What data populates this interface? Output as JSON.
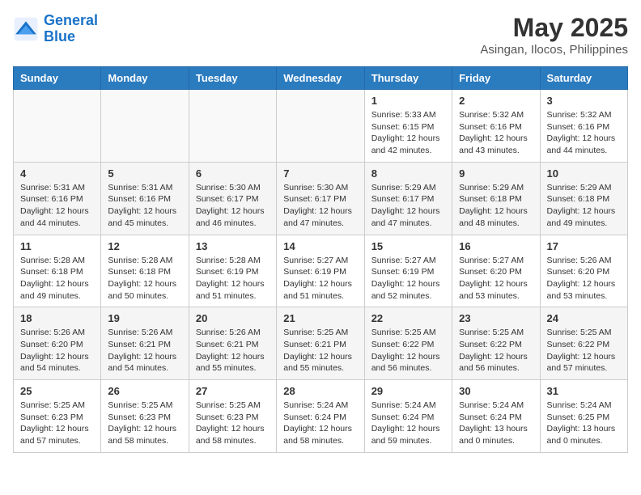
{
  "header": {
    "logo_line1": "General",
    "logo_line2": "Blue",
    "month": "May 2025",
    "location": "Asingan, Ilocos, Philippines"
  },
  "weekdays": [
    "Sunday",
    "Monday",
    "Tuesday",
    "Wednesday",
    "Thursday",
    "Friday",
    "Saturday"
  ],
  "weeks": [
    [
      {
        "day": "",
        "info": ""
      },
      {
        "day": "",
        "info": ""
      },
      {
        "day": "",
        "info": ""
      },
      {
        "day": "",
        "info": ""
      },
      {
        "day": "1",
        "info": "Sunrise: 5:33 AM\nSunset: 6:15 PM\nDaylight: 12 hours\nand 42 minutes."
      },
      {
        "day": "2",
        "info": "Sunrise: 5:32 AM\nSunset: 6:16 PM\nDaylight: 12 hours\nand 43 minutes."
      },
      {
        "day": "3",
        "info": "Sunrise: 5:32 AM\nSunset: 6:16 PM\nDaylight: 12 hours\nand 44 minutes."
      }
    ],
    [
      {
        "day": "4",
        "info": "Sunrise: 5:31 AM\nSunset: 6:16 PM\nDaylight: 12 hours\nand 44 minutes."
      },
      {
        "day": "5",
        "info": "Sunrise: 5:31 AM\nSunset: 6:16 PM\nDaylight: 12 hours\nand 45 minutes."
      },
      {
        "day": "6",
        "info": "Sunrise: 5:30 AM\nSunset: 6:17 PM\nDaylight: 12 hours\nand 46 minutes."
      },
      {
        "day": "7",
        "info": "Sunrise: 5:30 AM\nSunset: 6:17 PM\nDaylight: 12 hours\nand 47 minutes."
      },
      {
        "day": "8",
        "info": "Sunrise: 5:29 AM\nSunset: 6:17 PM\nDaylight: 12 hours\nand 47 minutes."
      },
      {
        "day": "9",
        "info": "Sunrise: 5:29 AM\nSunset: 6:18 PM\nDaylight: 12 hours\nand 48 minutes."
      },
      {
        "day": "10",
        "info": "Sunrise: 5:29 AM\nSunset: 6:18 PM\nDaylight: 12 hours\nand 49 minutes."
      }
    ],
    [
      {
        "day": "11",
        "info": "Sunrise: 5:28 AM\nSunset: 6:18 PM\nDaylight: 12 hours\nand 49 minutes."
      },
      {
        "day": "12",
        "info": "Sunrise: 5:28 AM\nSunset: 6:18 PM\nDaylight: 12 hours\nand 50 minutes."
      },
      {
        "day": "13",
        "info": "Sunrise: 5:28 AM\nSunset: 6:19 PM\nDaylight: 12 hours\nand 51 minutes."
      },
      {
        "day": "14",
        "info": "Sunrise: 5:27 AM\nSunset: 6:19 PM\nDaylight: 12 hours\nand 51 minutes."
      },
      {
        "day": "15",
        "info": "Sunrise: 5:27 AM\nSunset: 6:19 PM\nDaylight: 12 hours\nand 52 minutes."
      },
      {
        "day": "16",
        "info": "Sunrise: 5:27 AM\nSunset: 6:20 PM\nDaylight: 12 hours\nand 53 minutes."
      },
      {
        "day": "17",
        "info": "Sunrise: 5:26 AM\nSunset: 6:20 PM\nDaylight: 12 hours\nand 53 minutes."
      }
    ],
    [
      {
        "day": "18",
        "info": "Sunrise: 5:26 AM\nSunset: 6:20 PM\nDaylight: 12 hours\nand 54 minutes."
      },
      {
        "day": "19",
        "info": "Sunrise: 5:26 AM\nSunset: 6:21 PM\nDaylight: 12 hours\nand 54 minutes."
      },
      {
        "day": "20",
        "info": "Sunrise: 5:26 AM\nSunset: 6:21 PM\nDaylight: 12 hours\nand 55 minutes."
      },
      {
        "day": "21",
        "info": "Sunrise: 5:25 AM\nSunset: 6:21 PM\nDaylight: 12 hours\nand 55 minutes."
      },
      {
        "day": "22",
        "info": "Sunrise: 5:25 AM\nSunset: 6:22 PM\nDaylight: 12 hours\nand 56 minutes."
      },
      {
        "day": "23",
        "info": "Sunrise: 5:25 AM\nSunset: 6:22 PM\nDaylight: 12 hours\nand 56 minutes."
      },
      {
        "day": "24",
        "info": "Sunrise: 5:25 AM\nSunset: 6:22 PM\nDaylight: 12 hours\nand 57 minutes."
      }
    ],
    [
      {
        "day": "25",
        "info": "Sunrise: 5:25 AM\nSunset: 6:23 PM\nDaylight: 12 hours\nand 57 minutes."
      },
      {
        "day": "26",
        "info": "Sunrise: 5:25 AM\nSunset: 6:23 PM\nDaylight: 12 hours\nand 58 minutes."
      },
      {
        "day": "27",
        "info": "Sunrise: 5:25 AM\nSunset: 6:23 PM\nDaylight: 12 hours\nand 58 minutes."
      },
      {
        "day": "28",
        "info": "Sunrise: 5:24 AM\nSunset: 6:24 PM\nDaylight: 12 hours\nand 58 minutes."
      },
      {
        "day": "29",
        "info": "Sunrise: 5:24 AM\nSunset: 6:24 PM\nDaylight: 12 hours\nand 59 minutes."
      },
      {
        "day": "30",
        "info": "Sunrise: 5:24 AM\nSunset: 6:24 PM\nDaylight: 13 hours\nand 0 minutes."
      },
      {
        "day": "31",
        "info": "Sunrise: 5:24 AM\nSunset: 6:25 PM\nDaylight: 13 hours\nand 0 minutes."
      }
    ]
  ]
}
